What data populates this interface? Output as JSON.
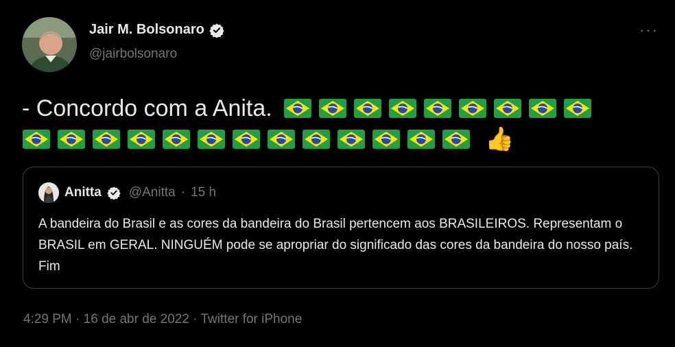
{
  "tweet": {
    "author": {
      "name": "Jair M. Bolsonaro",
      "handle": "@jairbolsonaro",
      "verified": true,
      "avatar": "portrait-photo"
    },
    "more_icon": "more-options-icon",
    "more_label": "···",
    "text": "- Concordo com a Anita.",
    "emoji": {
      "flag": "brazil-flag",
      "flag_count_line1": 9,
      "flag_count_line2": 13,
      "thumb": "👍"
    },
    "quote": {
      "author": {
        "name": "Anitta",
        "handle": "@Anitta",
        "verified": true
      },
      "separator": "·",
      "time": "15 h",
      "text": "A bandeira do Brasil e as cores da bandeira do Brasil pertencem aos BRASILEIROS. Representam o BRASIL em GERAL. NINGUÉM pode se apropriar do significado das cores da bandeira do nosso país. Fim"
    },
    "footer": {
      "time": "4:29 PM",
      "separator": "·",
      "date": "16 de abr de 2022",
      "source": "Twitter for iPhone",
      "full": "4:29 PM · 16 de abr de 2022 · Twitter for iPhone"
    }
  },
  "colors": {
    "background": "#000000",
    "text_primary": "#e7e9ea",
    "text_secondary": "#71767b",
    "border": "#3b3f43",
    "verified_badge": "#e7e9ea",
    "flag_green": "#229e45",
    "flag_yellow": "#f8e509",
    "flag_blue": "#2b49a3"
  }
}
